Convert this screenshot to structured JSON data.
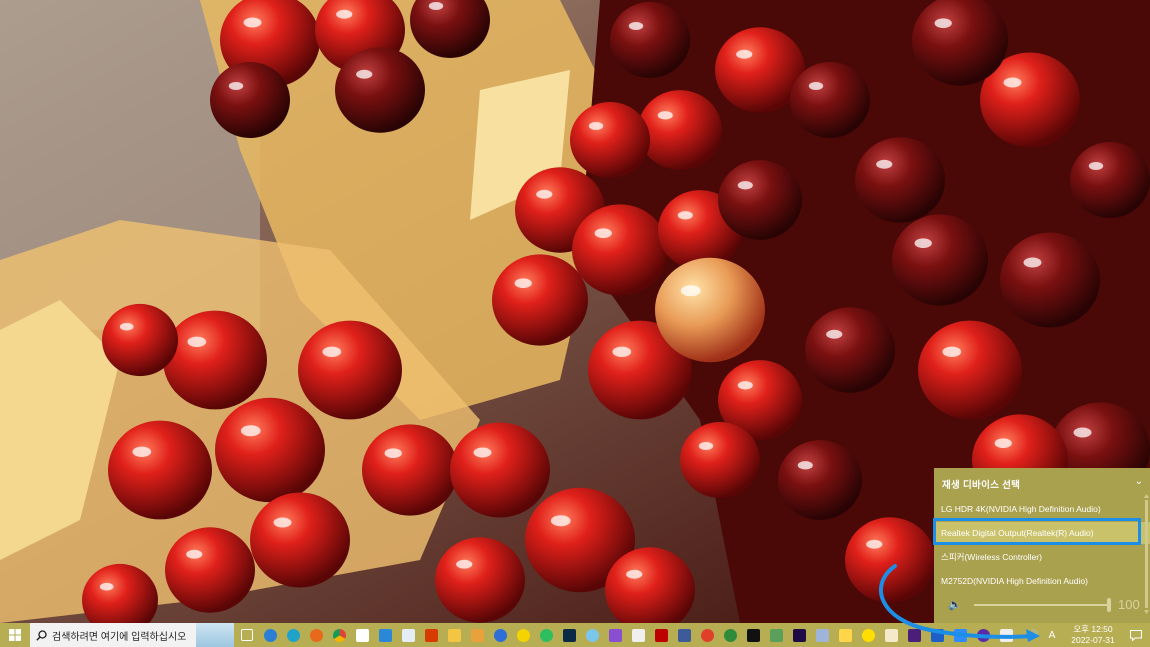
{
  "flyout": {
    "title": "재생 디바이스 선택",
    "devices": [
      {
        "label": "LG HDR 4K(NVIDIA High Definition Audio)",
        "selected": false
      },
      {
        "label": "Realtek Digital Output(Realtek(R) Audio)",
        "selected": true
      },
      {
        "label": "스피커(Wireless Controller)",
        "selected": false
      },
      {
        "label": "M2752D(NVIDIA High Definition Audio)",
        "selected": false
      }
    ],
    "volume": "100"
  },
  "taskbar": {
    "search_placeholder": "검색하려면 여기에 입력하십시오",
    "clock_time": "오후 12:50",
    "clock_date": "2022-07-31",
    "ime": "A"
  },
  "colors": {
    "taskbar": "#b7ad53",
    "flyout": "#aaa14f",
    "highlight": "#1d8ee6"
  }
}
